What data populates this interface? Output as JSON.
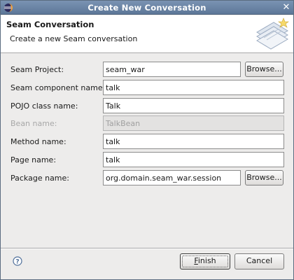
{
  "window": {
    "title": "Create New Conversation",
    "app_icon": "eclipse-icon",
    "close_icon": "close-icon"
  },
  "banner": {
    "title": "Seam Conversation",
    "description": "Create a new Seam conversation",
    "graphic": "wizard-banner-graphic"
  },
  "form": {
    "seam_project": {
      "label": "Seam Project:",
      "value": "seam_war",
      "browse_label": "Browse..."
    },
    "component_name": {
      "label": "Seam component name:",
      "value": "talk"
    },
    "pojo_class": {
      "label": "POJO class name:",
      "value": "Talk"
    },
    "bean_name": {
      "label": "Bean name:",
      "value": "TalkBean",
      "enabled": false
    },
    "method_name": {
      "label": "Method name:",
      "value": "talk"
    },
    "page_name": {
      "label": "Page name:",
      "value": "talk"
    },
    "package_name": {
      "label": "Package name:",
      "value": "org.domain.seam_war.session",
      "browse_label": "Browse..."
    }
  },
  "footer": {
    "help_icon": "help-icon",
    "finish_mnemonic": "F",
    "finish_rest": "inish",
    "cancel_label": "Cancel"
  },
  "colors": {
    "titlebar": "#6b84a6",
    "banner_bg": "#ffffff",
    "dialog_bg": "#edeceb",
    "disabled_text": "#a8a8a8"
  }
}
